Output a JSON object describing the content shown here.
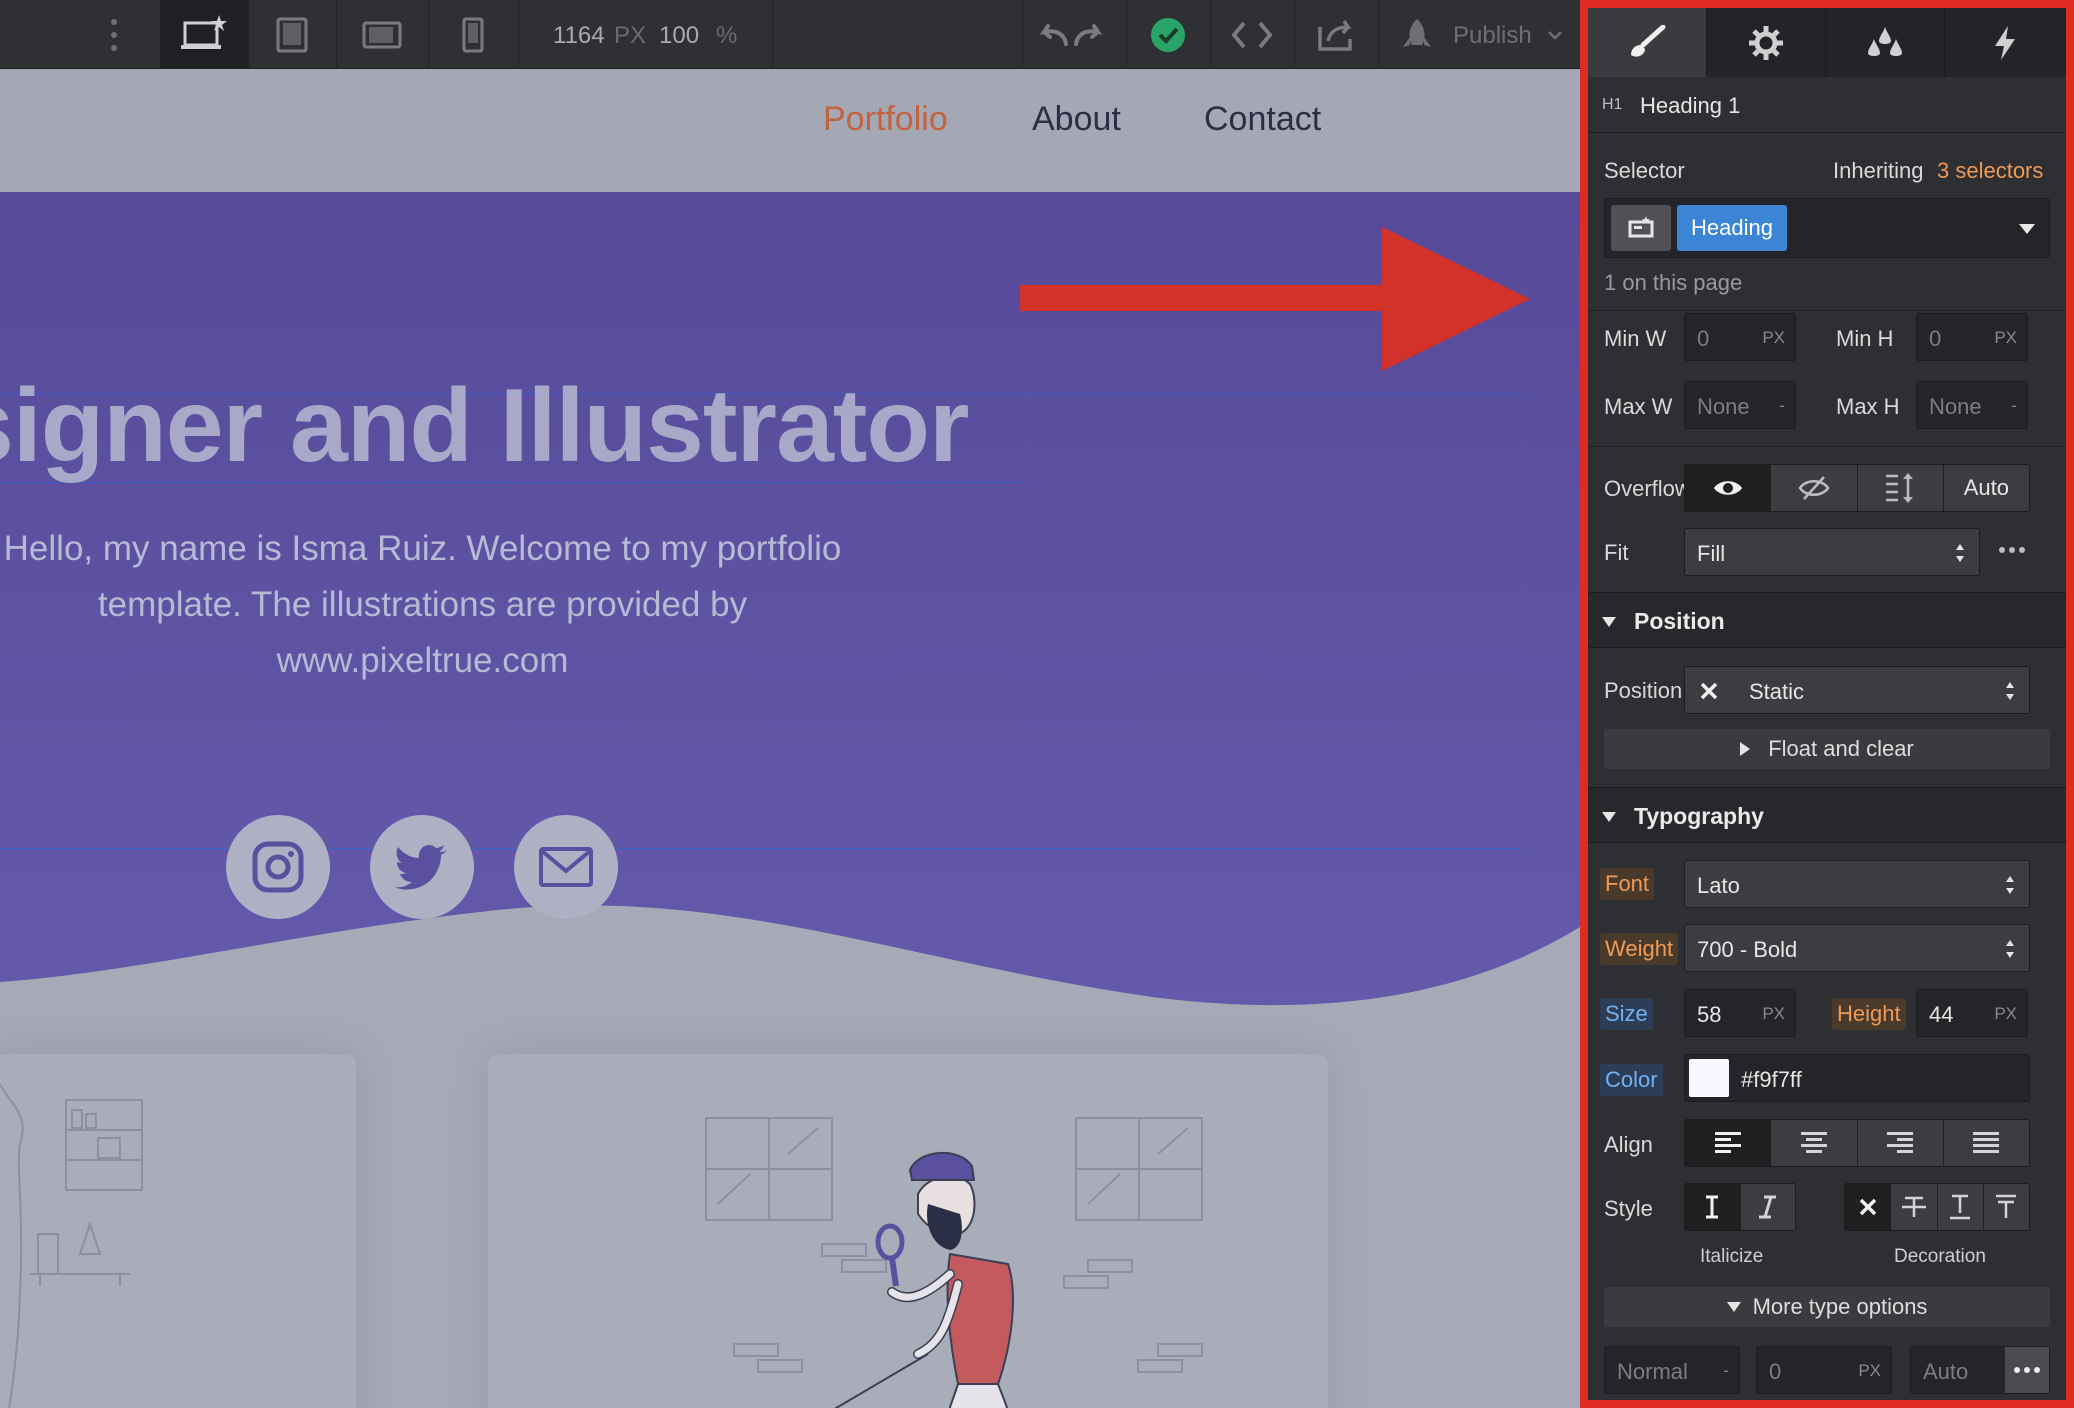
{
  "toolbar": {
    "width_value": "1164",
    "width_unit": "PX",
    "zoom_value": "100",
    "zoom_unit": "%",
    "publish_label": "Publish"
  },
  "site": {
    "nav": [
      "Portfolio",
      "About",
      "Contact"
    ],
    "hero_title": "signer and Illustrator",
    "hero_text": "Hello, my name is Isma Ruiz. Welcome to my portfolio template. The illustrations are provided by www.pixeltrue.com"
  },
  "panel": {
    "element_type": "H1",
    "element_name": "Heading 1",
    "selector_label": "Selector",
    "inheriting_prefix": "Inheriting",
    "inheriting_count": "3 selectors",
    "selector_chip": "Heading",
    "on_page": "1 on this page",
    "size": {
      "min_w_label": "Min W",
      "min_w_value": "0",
      "min_w_unit": "PX",
      "min_h_label": "Min H",
      "min_h_value": "0",
      "min_h_unit": "PX",
      "max_w_label": "Max W",
      "max_w_value": "None",
      "max_w_unit": "-",
      "max_h_label": "Max H",
      "max_h_value": "None",
      "max_h_unit": "-",
      "overflow_label": "Overflow",
      "overflow_auto": "Auto",
      "fit_label": "Fit",
      "fit_value": "Fill"
    },
    "position": {
      "section_title": "Position",
      "position_label": "Position",
      "position_value": "Static",
      "float_clear": "Float and clear"
    },
    "typography": {
      "section_title": "Typography",
      "font_label": "Font",
      "font_value": "Lato",
      "weight_label": "Weight",
      "weight_value": "700 - Bold",
      "size_label": "Size",
      "size_value": "58",
      "size_unit": "PX",
      "height_label": "Height",
      "height_value": "44",
      "height_unit": "PX",
      "color_label": "Color",
      "color_value": "#f9f7ff",
      "align_label": "Align",
      "style_label": "Style",
      "italicize_label": "Italicize",
      "decoration_label": "Decoration",
      "more_options": "More type options",
      "letter_value": "Normal",
      "letter_unit": "-",
      "indent_value": "0",
      "indent_unit": "PX",
      "columns_value": "Auto"
    }
  },
  "colors": {
    "panel_border": "#e02b23",
    "accent_orange": "#f09a53",
    "selector_blue": "#3c84d6",
    "hero_purple": "#5b4fa0",
    "nav_active": "#c2623f",
    "publish_check": "#2aa56a"
  }
}
